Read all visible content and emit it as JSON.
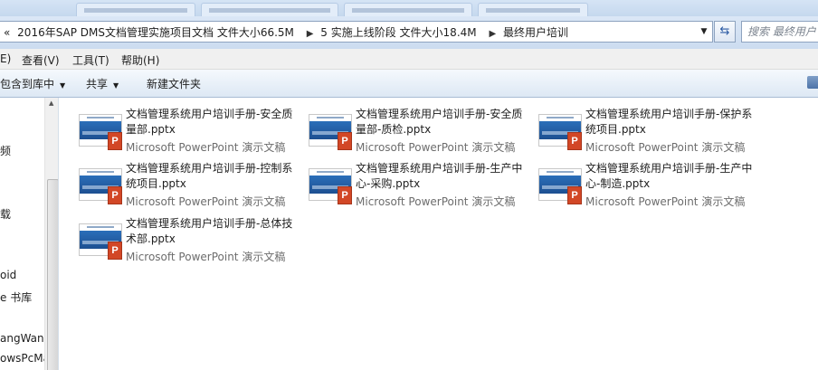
{
  "address": {
    "back_glyph": "«",
    "crumbs": [
      "2016年SAP DMS文档管理实施项目文档 文件大小66.5M",
      "5 实施上线阶段 文件大小18.4M",
      "最终用户培训"
    ],
    "separator": "▶",
    "dropdown_glyph": "▼",
    "refresh_glyph": "⇆",
    "search_placeholder": "搜索 最终用户"
  },
  "menu": [
    "E)",
    "查看(V)",
    "工具(T)",
    "帮助(H)"
  ],
  "commands": {
    "include_library": "包含到库中",
    "share": "共享",
    "new_folder": "新建文件夹",
    "caret": "▼"
  },
  "nav_items": [
    "频",
    "载",
    "oid",
    "e 书库",
    "angWan",
    "owsPcMa"
  ],
  "nav_scroll_up": "▲",
  "files": [
    {
      "name": "文档管理系统用户培训手册-安全质量部.pptx",
      "type": "Microsoft PowerPoint 演示文稿"
    },
    {
      "name": "文档管理系统用户培训手册-安全质量部-质检.pptx",
      "type": "Microsoft PowerPoint 演示文稿"
    },
    {
      "name": "文档管理系统用户培训手册-保护系统项目.pptx",
      "type": "Microsoft PowerPoint 演示文稿"
    },
    {
      "name": "文档管理系统用户培训手册-控制系统项目.pptx",
      "type": "Microsoft PowerPoint 演示文稿"
    },
    {
      "name": "文档管理系统用户培训手册-生产中心-采购.pptx",
      "type": "Microsoft PowerPoint 演示文稿"
    },
    {
      "name": "文档管理系统用户培训手册-生产中心-制造.pptx",
      "type": "Microsoft PowerPoint 演示文稿"
    },
    {
      "name": "文档管理系统用户培训手册-总体技术部.pptx",
      "type": "Microsoft PowerPoint 演示文稿"
    }
  ],
  "file_icon_letter": "P",
  "colors": {
    "ppt_badge": "#d24726",
    "address_border": "#8ea3bf",
    "type_text": "#6d6d6d"
  }
}
